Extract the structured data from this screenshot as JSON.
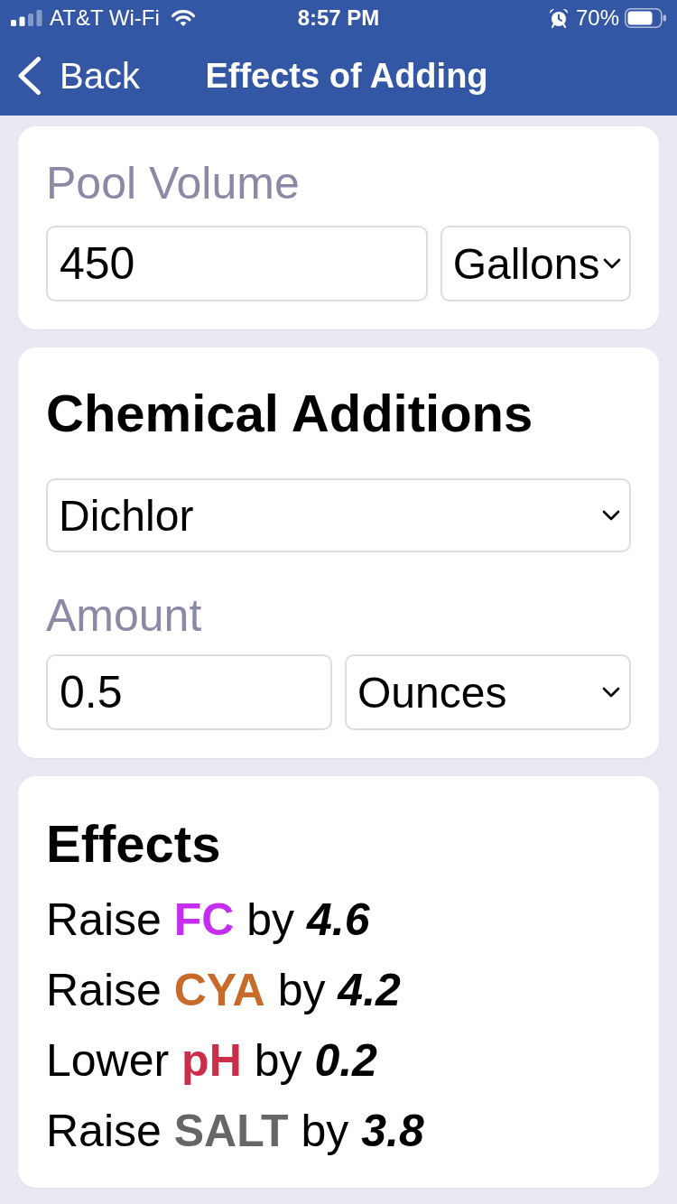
{
  "status_bar": {
    "carrier": "AT&T Wi-Fi",
    "time": "8:57 PM",
    "battery": "70%"
  },
  "nav": {
    "back": "Back",
    "title": "Effects of Adding"
  },
  "pool_volume": {
    "label": "Pool Volume",
    "value": "450",
    "unit": "Gallons"
  },
  "chemical_additions": {
    "title": "Chemical Additions",
    "chemical": "Dichlor",
    "amount_label": "Amount",
    "amount": "0.5",
    "unit": "Ounces"
  },
  "effects": {
    "title": "Effects",
    "items": [
      {
        "action": "Raise",
        "parameter": "FC",
        "color": "#c42ef0",
        "connector": "by",
        "amount": "4.6"
      },
      {
        "action": "Raise",
        "parameter": "CYA",
        "color": "#c86a2a",
        "connector": "by",
        "amount": "4.2"
      },
      {
        "action": "Lower",
        "parameter": "pH",
        "color": "#cc2e4a",
        "connector": "by",
        "amount": "0.2"
      },
      {
        "action": "Raise",
        "parameter": "SALT",
        "color": "#666666",
        "connector": "by",
        "amount": "3.8"
      }
    ]
  }
}
